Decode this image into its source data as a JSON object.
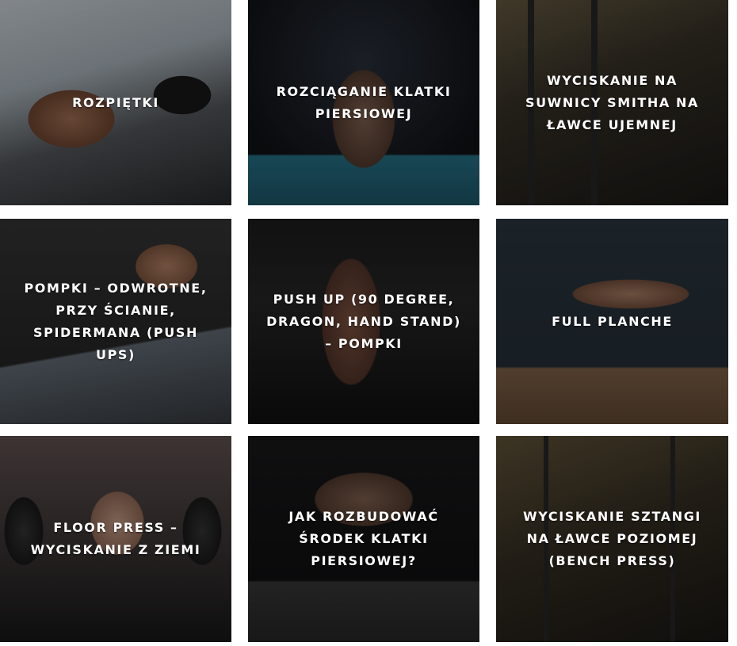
{
  "cards": [
    {
      "title": "ROZPIĘTKI"
    },
    {
      "title": "ROZCIĄGANIE KLATKI PIERSIOWEJ"
    },
    {
      "title": "WYCISKANIE NA SUWNICY SMITHA NA ŁAWCE UJEMNEJ"
    },
    {
      "title": "POMPKI – ODWROTNE, PRZY ŚCIANIE, SPIDERMANA (PUSH UPS)"
    },
    {
      "title": "PUSH UP (90 DEGREE, DRAGON, HAND STAND) – POMPKI"
    },
    {
      "title": "FULL PLANCHE"
    },
    {
      "title": "FLOOR PRESS – WYCISKANIE Z ZIEMI"
    },
    {
      "title": "JAK ROZBUDOWAĆ ŚRODEK KLATKI PIERSIOWEJ?"
    },
    {
      "title": "WYCISKANIE SZTANGI NA ŁAWCE POZIOMEJ (BENCH PRESS)"
    }
  ]
}
